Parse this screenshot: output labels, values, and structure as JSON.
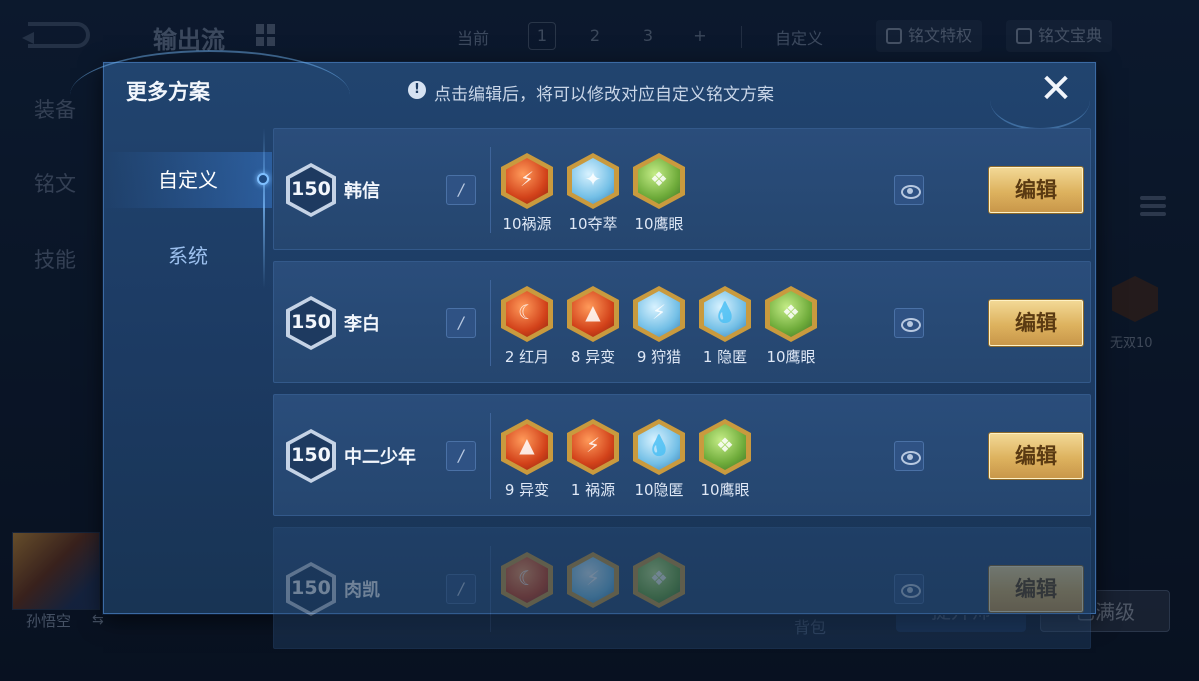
{
  "background": {
    "scheme_title": "输出流",
    "current_label": "当前",
    "pages": [
      "1",
      "2",
      "3",
      "+"
    ],
    "custom_label": "自定义",
    "privilege_label": "铭文特权",
    "treasure_label": "铭文宝典",
    "side_nav": [
      "装备",
      "铭文",
      "技能"
    ],
    "rune_badge_label": "无双10",
    "hero_name": "孙悟空",
    "bag_label": "背包",
    "buttons": [
      "提升师",
      "已满级"
    ]
  },
  "modal": {
    "title": "更多方案",
    "hint": "点击编辑后，将可以修改对应自定义铭文方案",
    "close_label": "✕",
    "tabs": [
      "自定义",
      "系统"
    ],
    "active_tab": "自定义",
    "edit_label": "编辑",
    "schemes": [
      {
        "level": "150",
        "hero": "韩信",
        "runes": [
          {
            "label": "10祸源",
            "color": "red",
            "icon": "rune-huoyuan-icon",
            "glyph": "⚡"
          },
          {
            "label": "10夺萃",
            "color": "blue",
            "icon": "rune-duocui-icon",
            "glyph": "✦"
          },
          {
            "label": "10鹰眼",
            "color": "green",
            "icon": "rune-yingyan-icon",
            "glyph": "❖"
          }
        ]
      },
      {
        "level": "150",
        "hero": "李白",
        "runes": [
          {
            "label": "2 红月",
            "color": "red",
            "icon": "rune-hongyue-icon",
            "glyph": "☾"
          },
          {
            "label": "8 异变",
            "color": "red",
            "icon": "rune-yibian-icon",
            "glyph": "▲"
          },
          {
            "label": "9 狩猎",
            "color": "blue",
            "icon": "rune-shoulie-icon",
            "glyph": "⚡"
          },
          {
            "label": "1 隐匿",
            "color": "blue",
            "icon": "rune-yinni-icon",
            "glyph": "💧"
          },
          {
            "label": "10鹰眼",
            "color": "green",
            "icon": "rune-yingyan-icon",
            "glyph": "❖"
          }
        ]
      },
      {
        "level": "150",
        "hero": "中二少年",
        "runes": [
          {
            "label": "9 异变",
            "color": "red",
            "icon": "rune-yibian-icon",
            "glyph": "▲"
          },
          {
            "label": "1 祸源",
            "color": "red",
            "icon": "rune-huoyuan-icon",
            "glyph": "⚡"
          },
          {
            "label": "10隐匿",
            "color": "blue",
            "icon": "rune-yinni-icon",
            "glyph": "💧"
          },
          {
            "label": "10鹰眼",
            "color": "green",
            "icon": "rune-yingyan-icon",
            "glyph": "❖"
          }
        ]
      },
      {
        "level": "150",
        "hero": "肉凯",
        "runes": [
          {
            "label": "",
            "color": "red",
            "icon": "rune-hongyue-icon",
            "glyph": "☾"
          },
          {
            "label": "",
            "color": "blue",
            "icon": "rune-shoulie-icon",
            "glyph": "⚡"
          },
          {
            "label": "",
            "color": "green",
            "icon": "rune-yingyan-icon",
            "glyph": "❖"
          }
        ]
      }
    ]
  },
  "colors": {
    "accent_gold": "#ddb25e",
    "panel_blue": "#21446f",
    "highlight": "#7fc0ff"
  }
}
